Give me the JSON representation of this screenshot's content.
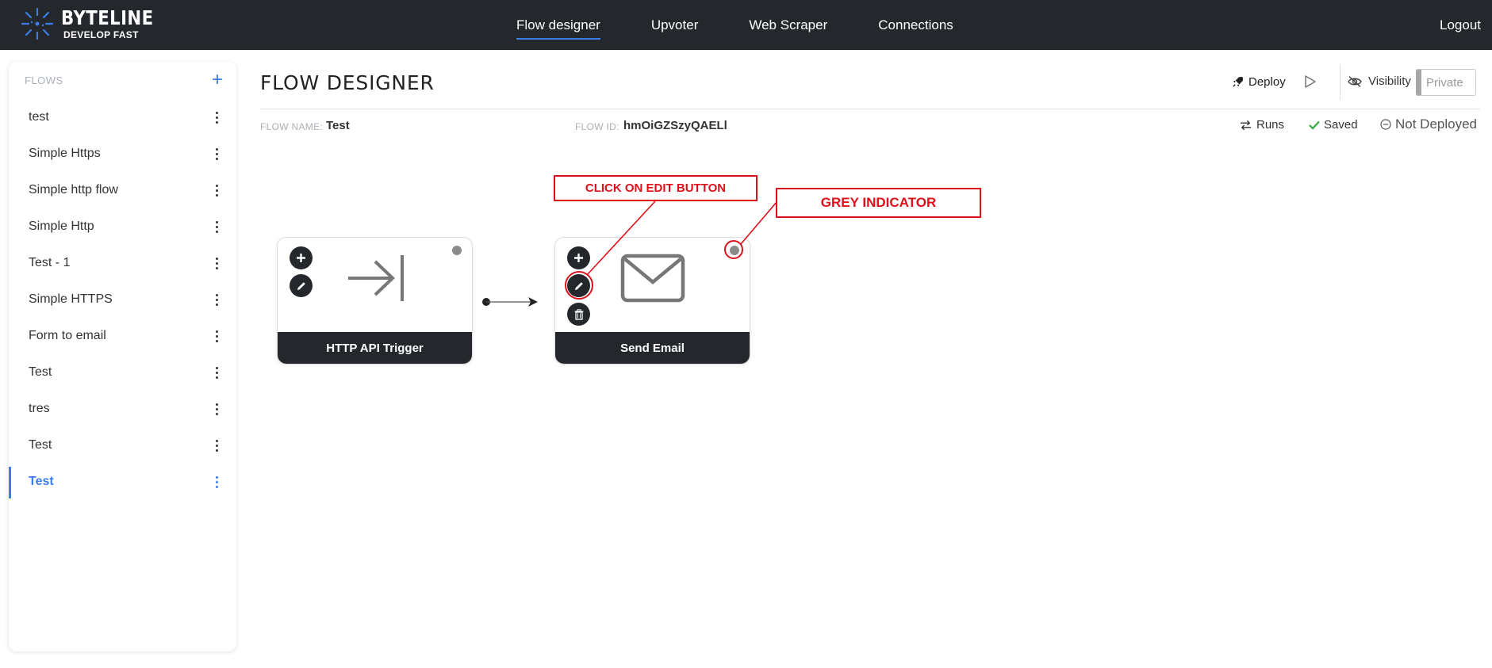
{
  "app": {
    "logo_title": "BYTELINE",
    "logo_subtitle": "DEVELOP FAST"
  },
  "nav": {
    "items": [
      {
        "label": "Flow designer",
        "active": true
      },
      {
        "label": "Upvoter",
        "active": false
      },
      {
        "label": "Web Scraper",
        "active": false
      },
      {
        "label": "Connections",
        "active": false
      }
    ],
    "logout_label": "Logout"
  },
  "sidebar": {
    "header": "FLOWS",
    "add_icon": "plus-icon",
    "items": [
      {
        "label": "test"
      },
      {
        "label": "Simple Https"
      },
      {
        "label": "Simple http flow"
      },
      {
        "label": "Simple Http"
      },
      {
        "label": "Test - 1"
      },
      {
        "label": "Simple HTTPS"
      },
      {
        "label": "Form to email"
      },
      {
        "label": "Test"
      },
      {
        "label": "tres"
      },
      {
        "label": "Test"
      },
      {
        "label": "Test"
      }
    ],
    "active_index": 10
  },
  "header": {
    "title": "FLOW DESIGNER",
    "deploy_label": "Deploy",
    "visibility_label": "Visibility",
    "private_label": "Private",
    "flow_name_label": "FLOW NAME:",
    "flow_name": "Test",
    "flow_id_label": "FLOW ID:",
    "flow_id": "hmOiGZSzyQAELl",
    "runs_label": "Runs",
    "saved_label": "Saved",
    "deploy_status": "Not Deployed"
  },
  "canvas": {
    "nodes": [
      {
        "title": "HTTP API Trigger",
        "icon": "arrow-to-bar-icon",
        "status_color": "#8a8a8a"
      },
      {
        "title": "Send Email",
        "icon": "envelope-icon",
        "status_color": "#8a8a8a"
      }
    ]
  },
  "annotations": {
    "edit_hint": "CLICK ON EDIT BUTTON",
    "indicator_hint": "GREY INDICATOR",
    "color": "#e0101a"
  },
  "colors": {
    "topbar": "#24272b",
    "accent": "#3b7de9",
    "saved_check": "#2eaa3f"
  }
}
